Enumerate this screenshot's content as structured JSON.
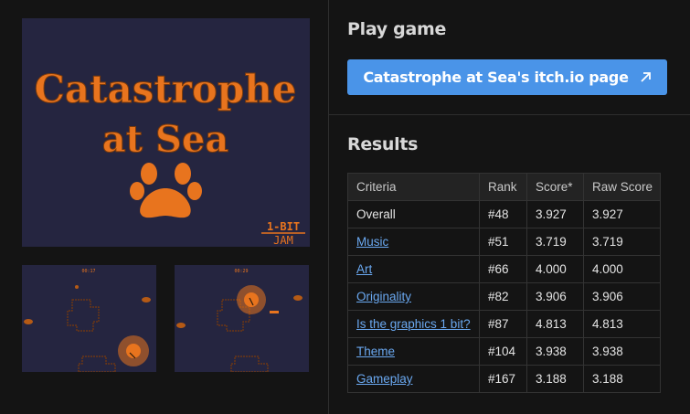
{
  "cover": {
    "title_line1": "Catastrophe",
    "title_line2": "at Sea",
    "badge_line1": "1-BIT",
    "badge_line2": "JAM"
  },
  "screenshots": [
    {
      "timer": "00:17"
    },
    {
      "timer": "00:29"
    }
  ],
  "play": {
    "title": "Play game",
    "button_label": "Catastrophe at Sea's itch.io page"
  },
  "results": {
    "title": "Results",
    "columns": [
      "Criteria",
      "Rank",
      "Score*",
      "Raw Score"
    ],
    "rows": [
      {
        "criteria": "Overall",
        "rank": "#48",
        "score": "3.927",
        "raw": "3.927",
        "link": false
      },
      {
        "criteria": "Music",
        "rank": "#51",
        "score": "3.719",
        "raw": "3.719",
        "link": true
      },
      {
        "criteria": "Art",
        "rank": "#66",
        "score": "4.000",
        "raw": "4.000",
        "link": true
      },
      {
        "criteria": "Originality",
        "rank": "#82",
        "score": "3.906",
        "raw": "3.906",
        "link": true
      },
      {
        "criteria": "Is the graphics 1 bit?",
        "rank": "#87",
        "score": "4.813",
        "raw": "4.813",
        "link": true
      },
      {
        "criteria": "Theme",
        "rank": "#104",
        "score": "3.938",
        "raw": "3.938",
        "link": true
      },
      {
        "criteria": "Gameplay",
        "rank": "#167",
        "score": "3.188",
        "raw": "3.188",
        "link": true
      }
    ]
  },
  "colors": {
    "accent_button": "#4a94e8",
    "link": "#6aa8f0",
    "game_orange": "#e8741e",
    "game_bg": "#252540"
  }
}
